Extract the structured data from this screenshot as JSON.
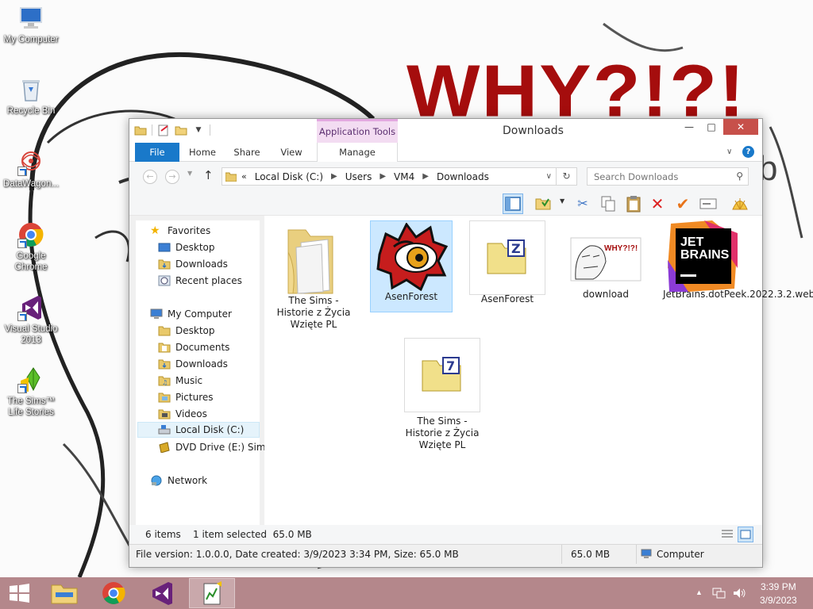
{
  "wallpaper": {
    "headline": "WHY?!?!",
    "subtext": "b"
  },
  "desktop_icons": [
    {
      "label": "My Computer",
      "icon": "computer-icon"
    },
    {
      "label": "Recycle Bin",
      "icon": "recycle-bin-icon"
    },
    {
      "label": "DataWagon...",
      "icon": "datawagon-icon"
    },
    {
      "label": "Google Chrome",
      "icon": "chrome-icon"
    },
    {
      "label": "Visual Studio 2013",
      "icon": "visual-studio-icon"
    },
    {
      "label": "The Sims™ Life Stories",
      "icon": "sims-icon"
    }
  ],
  "window": {
    "title": "Downloads",
    "context_tab_group": "Application Tools",
    "tabs": [
      "File",
      "Home",
      "Share",
      "View",
      "Manage"
    ],
    "address": {
      "chevron": "«",
      "crumbs": [
        "Local Disk (C:)",
        "Users",
        "VM4",
        "Downloads"
      ]
    },
    "search_placeholder": "Search Downloads",
    "nav": {
      "favorites": {
        "label": "Favorites",
        "items": [
          "Desktop",
          "Downloads",
          "Recent places"
        ]
      },
      "computer": {
        "label": "My Computer",
        "items": [
          "Desktop",
          "Documents",
          "Downloads",
          "Music",
          "Pictures",
          "Videos",
          "Local Disk (C:)",
          "DVD Drive (E:) SimsL"
        ]
      },
      "network": "Network"
    },
    "files": [
      {
        "name": "The Sims - Historie z Życia Wzięte PL",
        "type": "folder"
      },
      {
        "name": "AsenForest",
        "type": "exe"
      },
      {
        "name": "AsenForest",
        "type": "zip"
      },
      {
        "name": "download",
        "type": "image"
      },
      {
        "name": "JetBrains.dotPeek.2022.3.2.web",
        "type": "jetbrains"
      },
      {
        "name": "The Sims - Historie z Życia Wzięte PL",
        "type": "7z"
      }
    ],
    "jetbrains_logo": [
      "JET",
      "BRAINS"
    ],
    "download_thumb_text": "WHY?!?!",
    "view_status": {
      "items": "6 items",
      "selected": "1 item selected  65.0 MB"
    },
    "status": {
      "details": "File version: 1.0.0.0, Date created: 3/9/2023 3:34 PM, Size: 65.0 MB",
      "size": "65.0 MB",
      "location": "Computer"
    }
  },
  "taskbar": {
    "pinned": [
      "start-button",
      "file-explorer",
      "chrome",
      "visual-studio",
      "sims-setup"
    ],
    "clock": {
      "time": "3:39 PM",
      "date": "3/9/2023"
    }
  },
  "colors": {
    "file_tab": "#1979ca",
    "taskbar": "#b4878b",
    "close": "#c7504a",
    "selection": "#cce8ff",
    "context_tab": "#f3dcf2"
  }
}
